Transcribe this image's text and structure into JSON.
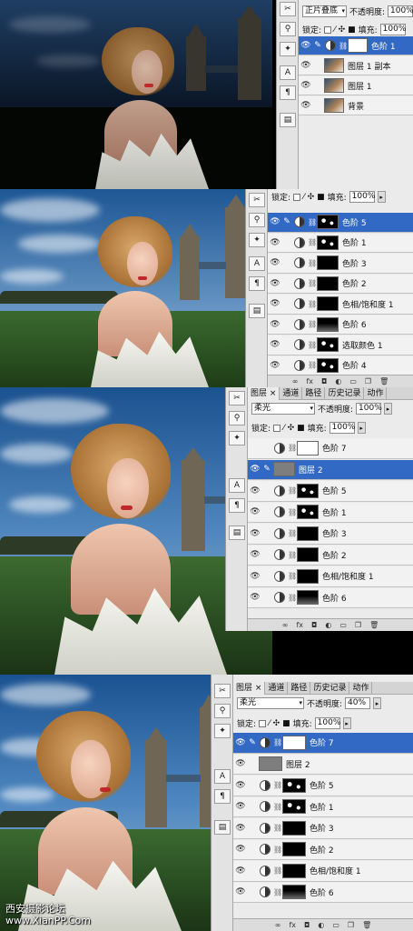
{
  "colors": {
    "accent": "#3269c5",
    "panel": "#ebebeb",
    "sky_top": "#1f4a80",
    "lips": "#c0282c"
  },
  "icons": [
    "brush-tool-icon",
    "stamp-tool-icon",
    "history-brush-icon",
    "type-tool-icon",
    "paragraph-icon",
    "notes-icon"
  ],
  "footer_icons": [
    "link-icon",
    "fx-icon",
    "mask-icon",
    "adjustment-icon",
    "group-folder-icon",
    "new-layer-icon",
    "trash-icon"
  ],
  "steps": [
    {
      "panel": {
        "blend_mode": "正片叠底",
        "opacity_label": "不透明度:",
        "opacity_value": "100%",
        "lock_label": "锁定:",
        "fill_label": "填充:",
        "fill_value": "100%",
        "layers": [
          {
            "name": "色阶 1",
            "visible": true,
            "selected": true,
            "adj": true,
            "mask": "white"
          },
          {
            "name": "图层 1 副本",
            "visible": true,
            "selected": false,
            "adj": false,
            "mask": "portrait"
          },
          {
            "name": "图层 1",
            "visible": true,
            "selected": false,
            "adj": false,
            "mask": "portrait"
          },
          {
            "name": "背景",
            "visible": true,
            "selected": false,
            "adj": false,
            "mask": "portrait"
          }
        ]
      }
    },
    {
      "panel": {
        "lock_label": "锁定:",
        "fill_label": "填充:",
        "fill_value": "100%",
        "layers": [
          {
            "name": "色阶 5",
            "visible": true,
            "selected": true,
            "adj": true,
            "mask": "spots"
          },
          {
            "name": "色阶 1",
            "visible": true,
            "selected": false,
            "adj": true,
            "mask": "spots"
          },
          {
            "name": "色阶 3",
            "visible": true,
            "selected": false,
            "adj": true,
            "mask": "black"
          },
          {
            "name": "色阶 2",
            "visible": true,
            "selected": false,
            "adj": true,
            "mask": "black"
          },
          {
            "name": "色相/饱和度 1",
            "visible": true,
            "selected": false,
            "adj": true,
            "mask": "black"
          },
          {
            "name": "色阶 6",
            "visible": true,
            "selected": false,
            "adj": true,
            "mask": "gradient"
          },
          {
            "name": "选取颜色 1",
            "visible": true,
            "selected": false,
            "adj": true,
            "mask": "spots"
          },
          {
            "name": "色阶 4",
            "visible": true,
            "selected": false,
            "adj": true,
            "mask": "spots"
          }
        ]
      }
    },
    {
      "panel": {
        "tabs": [
          "图层 ×",
          "通道",
          "路径",
          "历史记录",
          "动作"
        ],
        "blend_mode": "柔光",
        "opacity_label": "不透明度:",
        "opacity_value": "100%",
        "lock_label": "锁定:",
        "fill_label": "填充:",
        "fill_value": "100%",
        "layers": [
          {
            "name": "色阶 7",
            "visible": false,
            "selected": false,
            "adj": true,
            "mask": "white"
          },
          {
            "name": "图层 2",
            "visible": true,
            "selected": true,
            "adj": false,
            "mask": "gray"
          },
          {
            "name": "色阶 5",
            "visible": true,
            "selected": false,
            "adj": true,
            "mask": "spots"
          },
          {
            "name": "色阶 1",
            "visible": true,
            "selected": false,
            "adj": true,
            "mask": "spots"
          },
          {
            "name": "色阶 3",
            "visible": true,
            "selected": false,
            "adj": true,
            "mask": "black"
          },
          {
            "name": "色阶 2",
            "visible": true,
            "selected": false,
            "adj": true,
            "mask": "black"
          },
          {
            "name": "色相/饱和度 1",
            "visible": true,
            "selected": false,
            "adj": true,
            "mask": "black"
          },
          {
            "name": "色阶 6",
            "visible": true,
            "selected": false,
            "adj": true,
            "mask": "gradient"
          }
        ]
      }
    },
    {
      "panel": {
        "tabs": [
          "图层 ×",
          "通道",
          "路径",
          "历史记录",
          "动作"
        ],
        "blend_mode": "柔光",
        "opacity_label": "不透明度:",
        "opacity_value": "40%",
        "lock_label": "锁定:",
        "fill_label": "填充:",
        "fill_value": "100%",
        "layers": [
          {
            "name": "色阶 7",
            "visible": true,
            "selected": true,
            "adj": true,
            "mask": "white"
          },
          {
            "name": "图层 2",
            "visible": true,
            "selected": false,
            "adj": false,
            "mask": "gray"
          },
          {
            "name": "色阶 5",
            "visible": true,
            "selected": false,
            "adj": true,
            "mask": "spots"
          },
          {
            "name": "色阶 1",
            "visible": true,
            "selected": false,
            "adj": true,
            "mask": "spots"
          },
          {
            "name": "色阶 3",
            "visible": true,
            "selected": false,
            "adj": true,
            "mask": "black"
          },
          {
            "name": "色阶 2",
            "visible": true,
            "selected": false,
            "adj": true,
            "mask": "black"
          },
          {
            "name": "色相/饱和度 1",
            "visible": true,
            "selected": false,
            "adj": true,
            "mask": "black"
          },
          {
            "name": "色阶 6",
            "visible": true,
            "selected": false,
            "adj": true,
            "mask": "gradient"
          }
        ]
      }
    }
  ],
  "watermark": {
    "line1": "西安摄影论坛",
    "line2": "www.XianPP.Com"
  }
}
